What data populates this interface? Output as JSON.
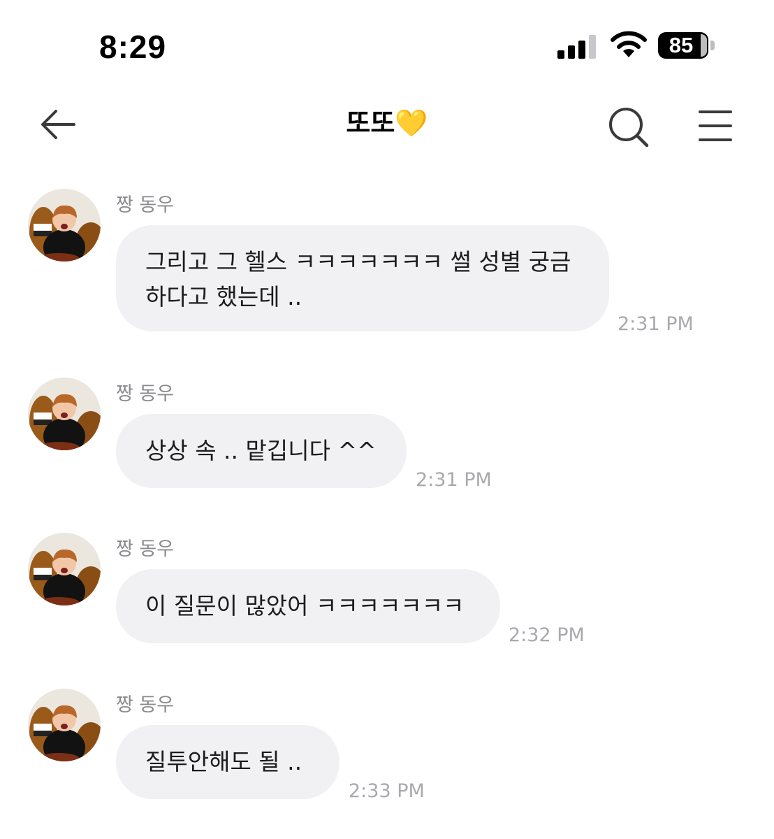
{
  "status_bar": {
    "time": "8:29",
    "battery": "85",
    "battery_level_percent": 85,
    "signal_bars": 3,
    "signal_bars_total": 4
  },
  "header": {
    "title": "또또💛",
    "back_icon": "arrow-left-icon",
    "search_icon": "search-icon",
    "menu_icon": "hamburger-menu-icon"
  },
  "colors": {
    "bubble_background": "#f1f1f4",
    "timestamp": "#a9a9ae",
    "sender_name": "#8a8a8e"
  },
  "messages": [
    {
      "sender": "짱 동우",
      "lines": [
        "그리고 그 헬스 ㅋㅋㅋㅋㅋㅋㅋ 썰 성별 궁금",
        "하다고 했는데 .."
      ],
      "time": "2:31 PM"
    },
    {
      "sender": "짱 동우",
      "lines": [
        "상상 속 .. 맡깁니다 ^^"
      ],
      "time": "2:31 PM"
    },
    {
      "sender": "짱 동우",
      "lines": [
        "이 질문이 많았어 ㅋㅋㅋㅋㅋㅋㅋ"
      ],
      "time": "2:32 PM"
    },
    {
      "sender": "짱 동우",
      "lines": [
        "질투안해도 될 .."
      ],
      "time": "2:33 PM"
    }
  ]
}
